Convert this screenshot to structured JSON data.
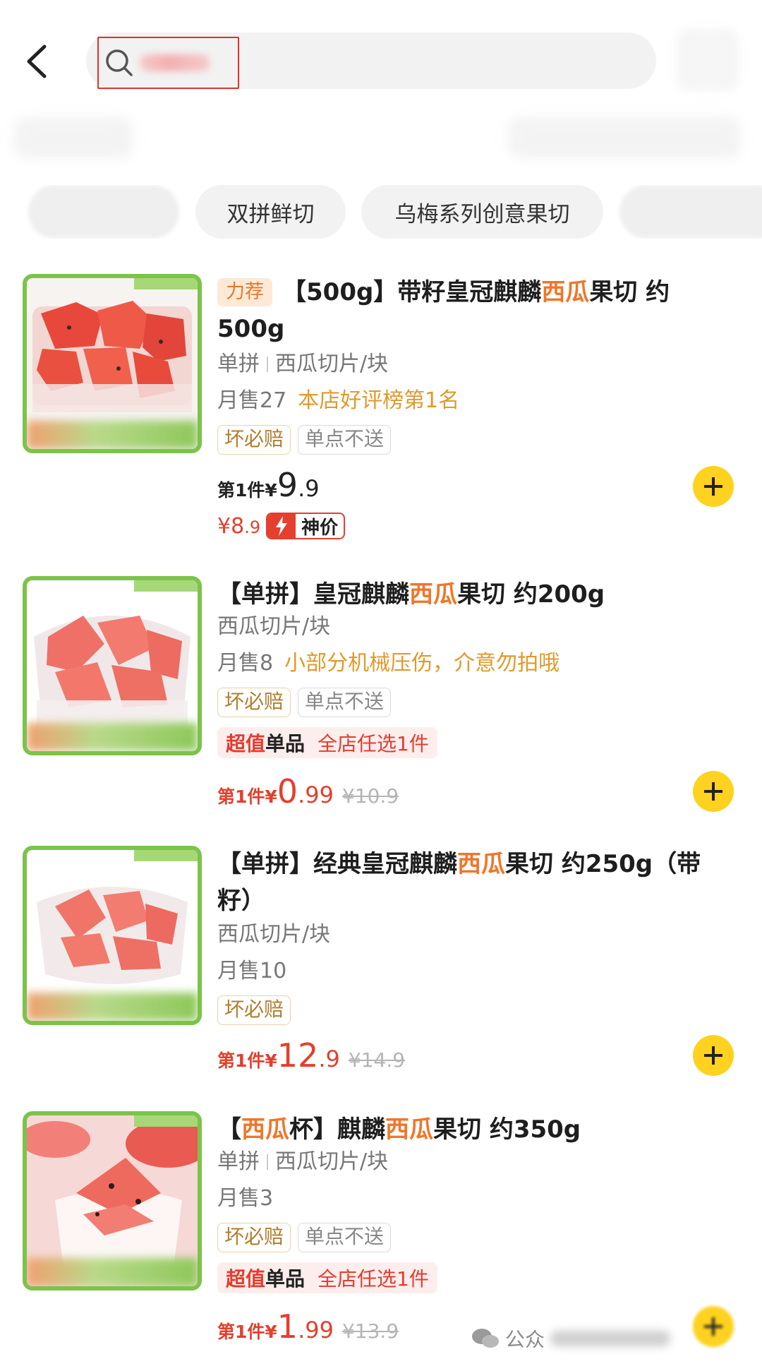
{
  "header": {
    "back_icon": "chevron-left-icon",
    "search_icon": "search-icon"
  },
  "chips": [
    {
      "label": ""
    },
    {
      "label": "双拼鲜切"
    },
    {
      "label": "乌梅系列创意果切"
    },
    {
      "label": ""
    }
  ],
  "products": [
    {
      "hot_tag": "力荐",
      "title_pre": "【500g】带籽皇冠麒麟",
      "title_hl": "西瓜",
      "title_post": "果切 约500g",
      "spec_a": "单拼",
      "spec_b": "西瓜切片/块",
      "sales": "月售27",
      "note": "本店好评榜第1名",
      "badge1": "坏必赔",
      "badge2": "单点不送",
      "price_pre": "第1件¥",
      "price_int": "9",
      "price_dec": ".9",
      "sub_price_int": "¥8",
      "sub_price_dec": ".9",
      "deal_label": "神价"
    },
    {
      "title_pre": "【单拼】皇冠麒麟",
      "title_hl": "西瓜",
      "title_post": "果切 约200g",
      "spec": "西瓜切片/块",
      "sales": "月售8",
      "note": "小部分机械压伤，介意勿拍哦",
      "badge1": "坏必赔",
      "badge2": "单点不送",
      "promo_1": "超值",
      "promo_2": "单品",
      "promo_3": "全店任选1件",
      "price_pre": "第1件¥",
      "price_int": "0",
      "price_dec": ".99",
      "price_old": "¥10.9"
    },
    {
      "title_pre": "【单拼】经典皇冠麒麟",
      "title_hl": "西瓜",
      "title_post": "果切 约250g（带籽）",
      "spec": "西瓜切片/块",
      "sales": "月售10",
      "badge1": "坏必赔",
      "price_pre": "第1件¥",
      "price_int": "12",
      "price_dec": ".9",
      "price_old": "¥14.9"
    },
    {
      "title_pre": "【",
      "title_hl": "西瓜",
      "title_mid": "杯】麒麟",
      "title_hl2": "西瓜",
      "title_post": "果切 约350g",
      "spec_a": "单拼",
      "spec_b": "西瓜切片/块",
      "sales": "月售3",
      "badge1": "坏必赔",
      "badge2": "单点不送",
      "promo_1": "超值",
      "promo_2": "单品",
      "promo_3": "全店任选1件",
      "price_pre": "第1件¥",
      "price_int": "1",
      "price_dec": ".99",
      "price_old": "¥13.9"
    }
  ],
  "watermark": {
    "text": "公众"
  },
  "colors": {
    "accent": "#f0762a",
    "price_red": "#e3402e",
    "add_button": "#ffd21f",
    "thumb_border": "#7cc34a"
  }
}
